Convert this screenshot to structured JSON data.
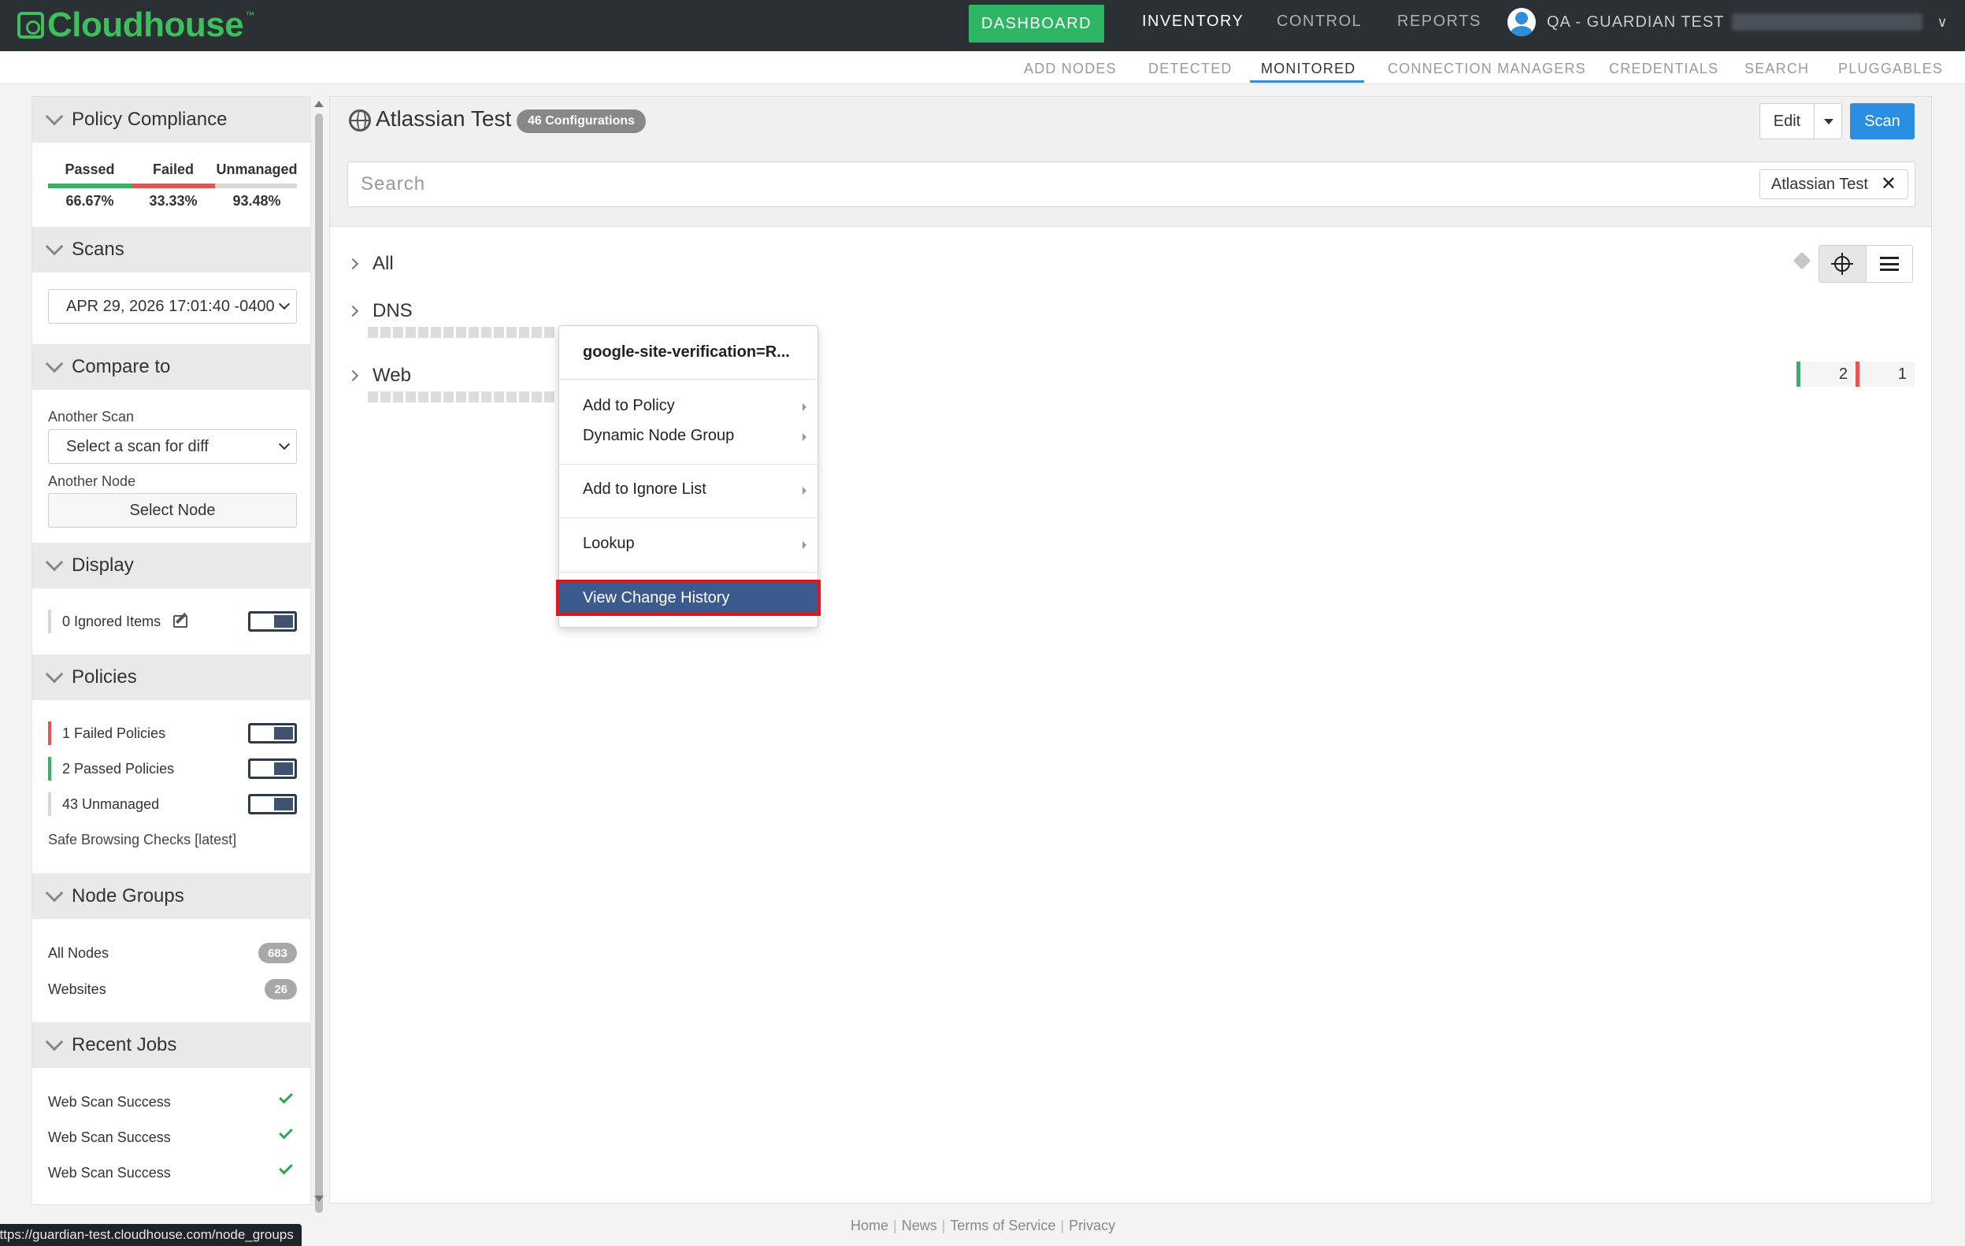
{
  "app": {
    "brand": "Cloudhouse",
    "brand_tm": "™"
  },
  "topnav": {
    "dashboard": "DASHBOARD",
    "inventory": "INVENTORY",
    "control": "CONTROL",
    "reports": "REPORTS",
    "user_label": "QA - GUARDIAN TEST"
  },
  "subnav": {
    "items": [
      "ADD NODES",
      "DETECTED",
      "MONITORED",
      "CONNECTION MANAGERS",
      "CREDENTIALS",
      "SEARCH",
      "PLUGGABLES"
    ],
    "active": "MONITORED"
  },
  "sidebar": {
    "policy_compliance": {
      "title": "Policy Compliance",
      "passed_label": "Passed",
      "failed_label": "Failed",
      "unmanaged_label": "Unmanaged",
      "passed_value": "66.67%",
      "failed_value": "33.33%",
      "unmanaged_value": "93.48%",
      "passed_color": "#2fb665",
      "failed_color": "#e8524f",
      "unmanaged_color": "#d8d8d8"
    },
    "scans": {
      "title": "Scans",
      "selected": "APR 29, 2026 17:01:40 -0400"
    },
    "compare": {
      "title": "Compare to",
      "another_scan_label": "Another Scan",
      "scan_select": "Select a scan for diff",
      "another_node_label": "Another Node",
      "select_node": "Select Node"
    },
    "display": {
      "title": "Display",
      "ignored_items": "0 Ignored Items"
    },
    "policies": {
      "title": "Policies",
      "failed": "1 Failed Policies",
      "passed": "2 Passed Policies",
      "unmanaged": "43 Unmanaged",
      "safe_browsing": "Safe Browsing Checks [latest]"
    },
    "node_groups": {
      "title": "Node Groups",
      "items": [
        {
          "label": "All Nodes",
          "count": "683"
        },
        {
          "label": "Websites",
          "count": "26"
        }
      ]
    },
    "recent_jobs": {
      "title": "Recent Jobs",
      "items": [
        "Web Scan Success",
        "Web Scan Success",
        "Web Scan Success"
      ]
    }
  },
  "main": {
    "title": "Atlassian Test",
    "config_badge": "46 Configurations",
    "edit": "Edit",
    "scan": "Scan",
    "search_placeholder": "Search",
    "search_tag": "Atlassian Test",
    "tree": {
      "all": "All",
      "dns": "DNS",
      "web": "Web"
    },
    "web_counts": {
      "passed": "2",
      "failed": "1"
    }
  },
  "context_menu": {
    "title": "google-site-verification=R...",
    "items": {
      "add_to_policy": "Add to Policy",
      "dynamic_node_group": "Dynamic Node Group",
      "add_to_ignore": "Add to Ignore List",
      "lookup": "Lookup",
      "view_change_history": "View Change History"
    }
  },
  "footer": {
    "home": "Home",
    "news": "News",
    "terms": "Terms of Service",
    "privacy": "Privacy",
    "sep": "|"
  },
  "statusbar": {
    "url": "https://guardian-test.cloudhouse.com/node_groups"
  }
}
